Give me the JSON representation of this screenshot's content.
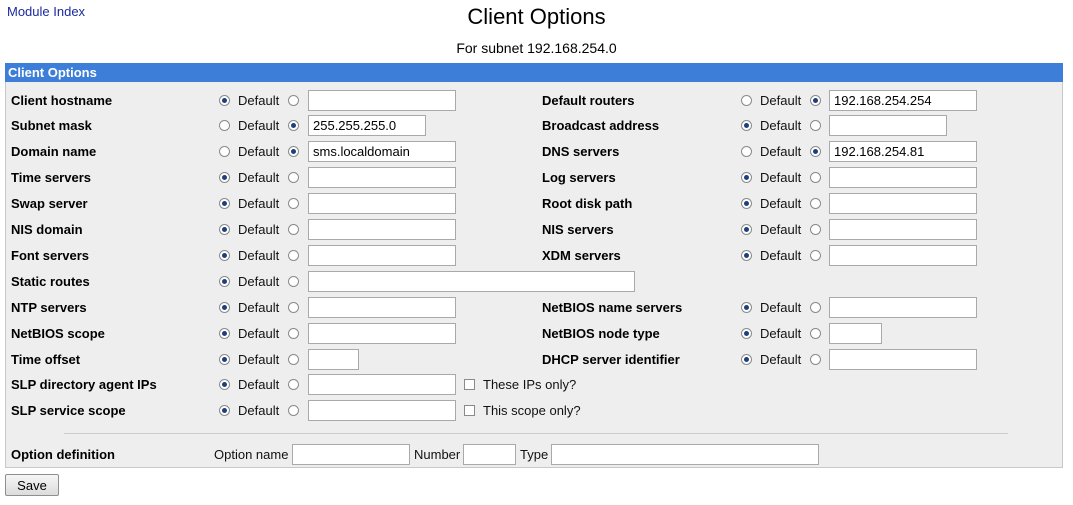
{
  "nav": {
    "module_index": "Module Index"
  },
  "header": {
    "title": "Client Options",
    "subtitle": "For subnet 192.168.254.0"
  },
  "panel": {
    "title": "Client Options"
  },
  "common": {
    "default_label": "Default"
  },
  "left_options": [
    {
      "label": "Client hostname",
      "default_selected": true,
      "value": ""
    },
    {
      "label": "Subnet mask",
      "default_selected": false,
      "value": "255.255.255.0"
    },
    {
      "label": "Domain name",
      "default_selected": false,
      "value": "sms.localdomain"
    },
    {
      "label": "Time servers",
      "default_selected": true,
      "value": ""
    },
    {
      "label": "Swap server",
      "default_selected": true,
      "value": ""
    },
    {
      "label": "NIS domain",
      "default_selected": true,
      "value": ""
    },
    {
      "label": "Font servers",
      "default_selected": true,
      "value": ""
    },
    {
      "label": "Static routes",
      "default_selected": true,
      "value": ""
    },
    {
      "label": "NTP servers",
      "default_selected": true,
      "value": ""
    },
    {
      "label": "NetBIOS scope",
      "default_selected": true,
      "value": ""
    },
    {
      "label": "Time offset",
      "default_selected": true,
      "value": ""
    },
    {
      "label": "SLP directory agent IPs",
      "default_selected": true,
      "value": "",
      "checkbox_label": "These IPs only?",
      "checkbox_checked": false
    },
    {
      "label": "SLP service scope",
      "default_selected": true,
      "value": "",
      "checkbox_label": "This scope only?",
      "checkbox_checked": false
    }
  ],
  "right_options": [
    {
      "label": "Default routers",
      "default_selected": false,
      "value": "192.168.254.254"
    },
    {
      "label": "Broadcast address",
      "default_selected": true,
      "value": ""
    },
    {
      "label": "DNS servers",
      "default_selected": false,
      "value": "192.168.254.81"
    },
    {
      "label": "Log servers",
      "default_selected": true,
      "value": ""
    },
    {
      "label": "Root disk path",
      "default_selected": true,
      "value": ""
    },
    {
      "label": "NIS servers",
      "default_selected": true,
      "value": ""
    },
    {
      "label": "XDM servers",
      "default_selected": true,
      "value": ""
    },
    {
      "label": "NetBIOS name servers",
      "default_selected": true,
      "value": ""
    },
    {
      "label": "NetBIOS node type",
      "default_selected": true,
      "value": ""
    },
    {
      "label": "DHCP server identifier",
      "default_selected": true,
      "value": ""
    }
  ],
  "option_definition": {
    "label": "Option definition",
    "name_label": "Option name",
    "name_value": "",
    "number_label": "Number",
    "number_value": "",
    "type_label": "Type",
    "type_value": ""
  },
  "actions": {
    "save_label": "Save"
  }
}
